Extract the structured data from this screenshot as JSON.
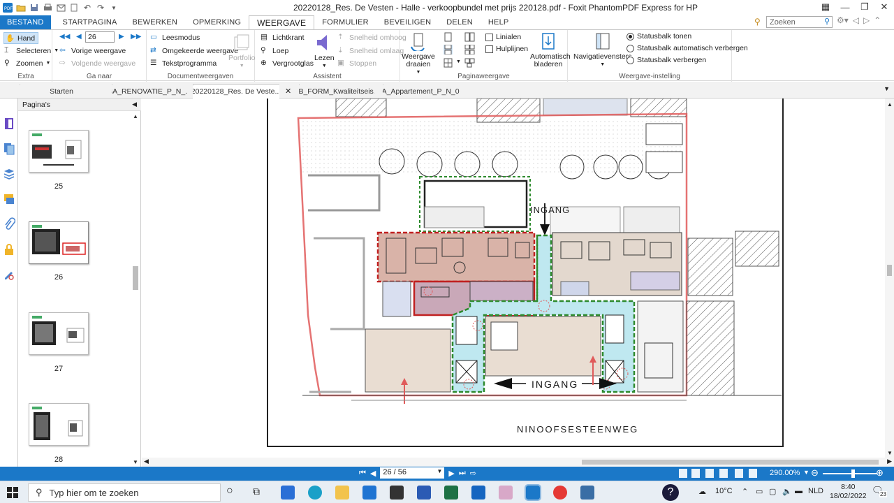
{
  "window": {
    "title": "20220128_Res. De Vesten - Halle - verkoopbundel met prijs 220128.pdf - Foxit PhantomPDF Express for HP"
  },
  "menu": {
    "tabs": [
      {
        "label": "BESTAND"
      },
      {
        "label": "STARTPAGINA"
      },
      {
        "label": "BEWERKEN"
      },
      {
        "label": "OPMERKING"
      },
      {
        "label": "WEERGAVE"
      },
      {
        "label": "FORMULIER"
      },
      {
        "label": "BEVEILIGEN"
      },
      {
        "label": "DELEN"
      },
      {
        "label": "HELP"
      }
    ],
    "active": "WEERGAVE",
    "search_placeholder": "Zoeken"
  },
  "ribbon": {
    "extra": {
      "hand": "Hand",
      "select": "Selecteren",
      "zoom": "Zoomen",
      "label": "Extra"
    },
    "ganaar": {
      "page_value": "26",
      "prev_view": "Vorige weergave",
      "next_view": "Volgende weergave",
      "label": "Ga naar"
    },
    "docviews": {
      "read": "Leesmodus",
      "reverse": "Omgekeerde weergave",
      "text": "Tekstprogramma",
      "portfolio": "Portfolio",
      "label": "Documentweergaven"
    },
    "assistant": {
      "ticker": "Lichtkrant",
      "loupe": "Loep",
      "magnifier": "Vergrootglas",
      "read": "Lezen",
      "faster": "Snelheid omhoog",
      "slower": "Snelheid omlaag",
      "stop": "Stoppen",
      "label": "Assistent"
    },
    "pageview": {
      "rotate": "Weergave draaien",
      "rulers": "Linialen",
      "guides": "Hulplijnen",
      "autoscroll": "Automatisch bladeren",
      "label": "Paginaweergave"
    },
    "viewsettings": {
      "navpanes": "Navigatievensters",
      "show_status": "Statusbalk tonen",
      "auto_hide": "Statusbalk automatisch verbergen",
      "hide": "Statusbalk verbergen",
      "label": "Weergave-instelling"
    }
  },
  "doc_tabs": [
    {
      "label": "Starten"
    },
    {
      "label": "BA_RENOVATIE_P_N_..."
    },
    {
      "label": "20220128_Res. De Veste..."
    },
    {
      "label": "EB_FORM_Kwaliteitseis..."
    },
    {
      "label": "BA_Appartement_P_N_0..."
    }
  ],
  "panel": {
    "title": "Pagina's",
    "thumbs": [
      {
        "label": "25"
      },
      {
        "label": "26"
      },
      {
        "label": "27"
      },
      {
        "label": "28"
      }
    ]
  },
  "drawing": {
    "entrance_top": "INGANG",
    "entrance_bottom": "INGANG",
    "street": "NINOOFSESTEENWEG"
  },
  "statusbar": {
    "page_display": "26 / 56",
    "zoom": "290.00%"
  },
  "taskbar": {
    "search_placeholder": "Typ hier om te zoeken",
    "temperature": "10°C",
    "language": "NLD",
    "time": "8:40",
    "date": "18/02/2022",
    "notifications": "23"
  },
  "colors": {
    "accent": "#1b78c8",
    "plan_red": "#e05b5b",
    "plan_green": "#2d8a2d",
    "stair_cyan": "#bfe8f0"
  }
}
